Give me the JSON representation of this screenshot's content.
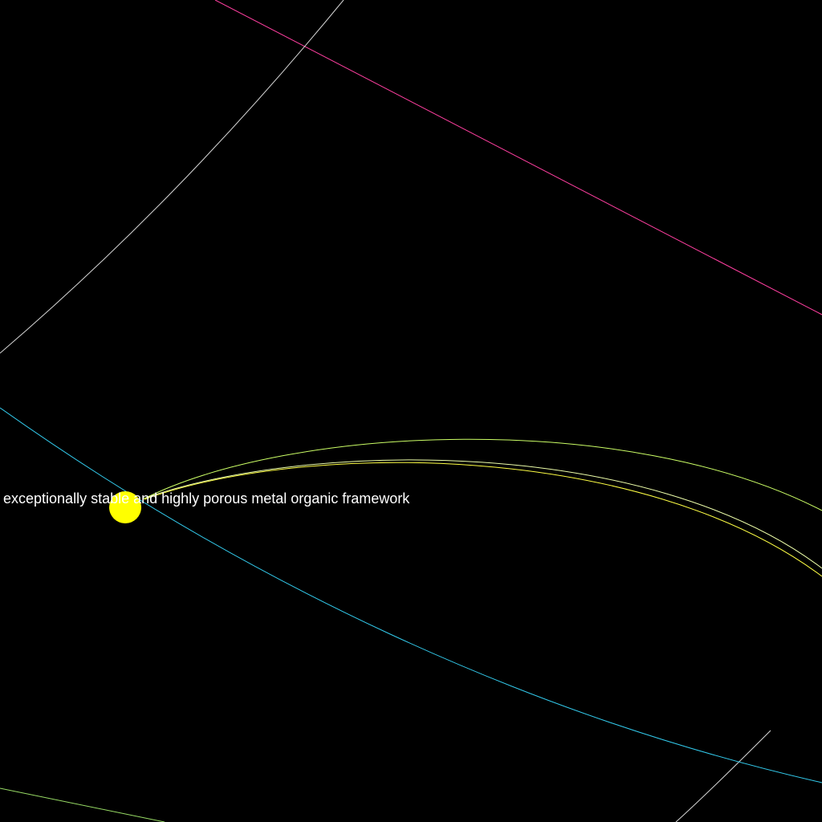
{
  "scene": {
    "background": "#000000",
    "node": {
      "label": "exceptionally stable and highly porous metal organic framework",
      "color": "#ffff00",
      "label_color": "#ffffff"
    },
    "orbit_colors": {
      "magenta": "#ff3fa0",
      "white": "#d8d8d8",
      "cyan": "#33ccee",
      "light_green": "#ccff66",
      "yellow": "#ffff44",
      "pale_green": "#eeffaa",
      "bottom_green": "#99dd66"
    }
  }
}
